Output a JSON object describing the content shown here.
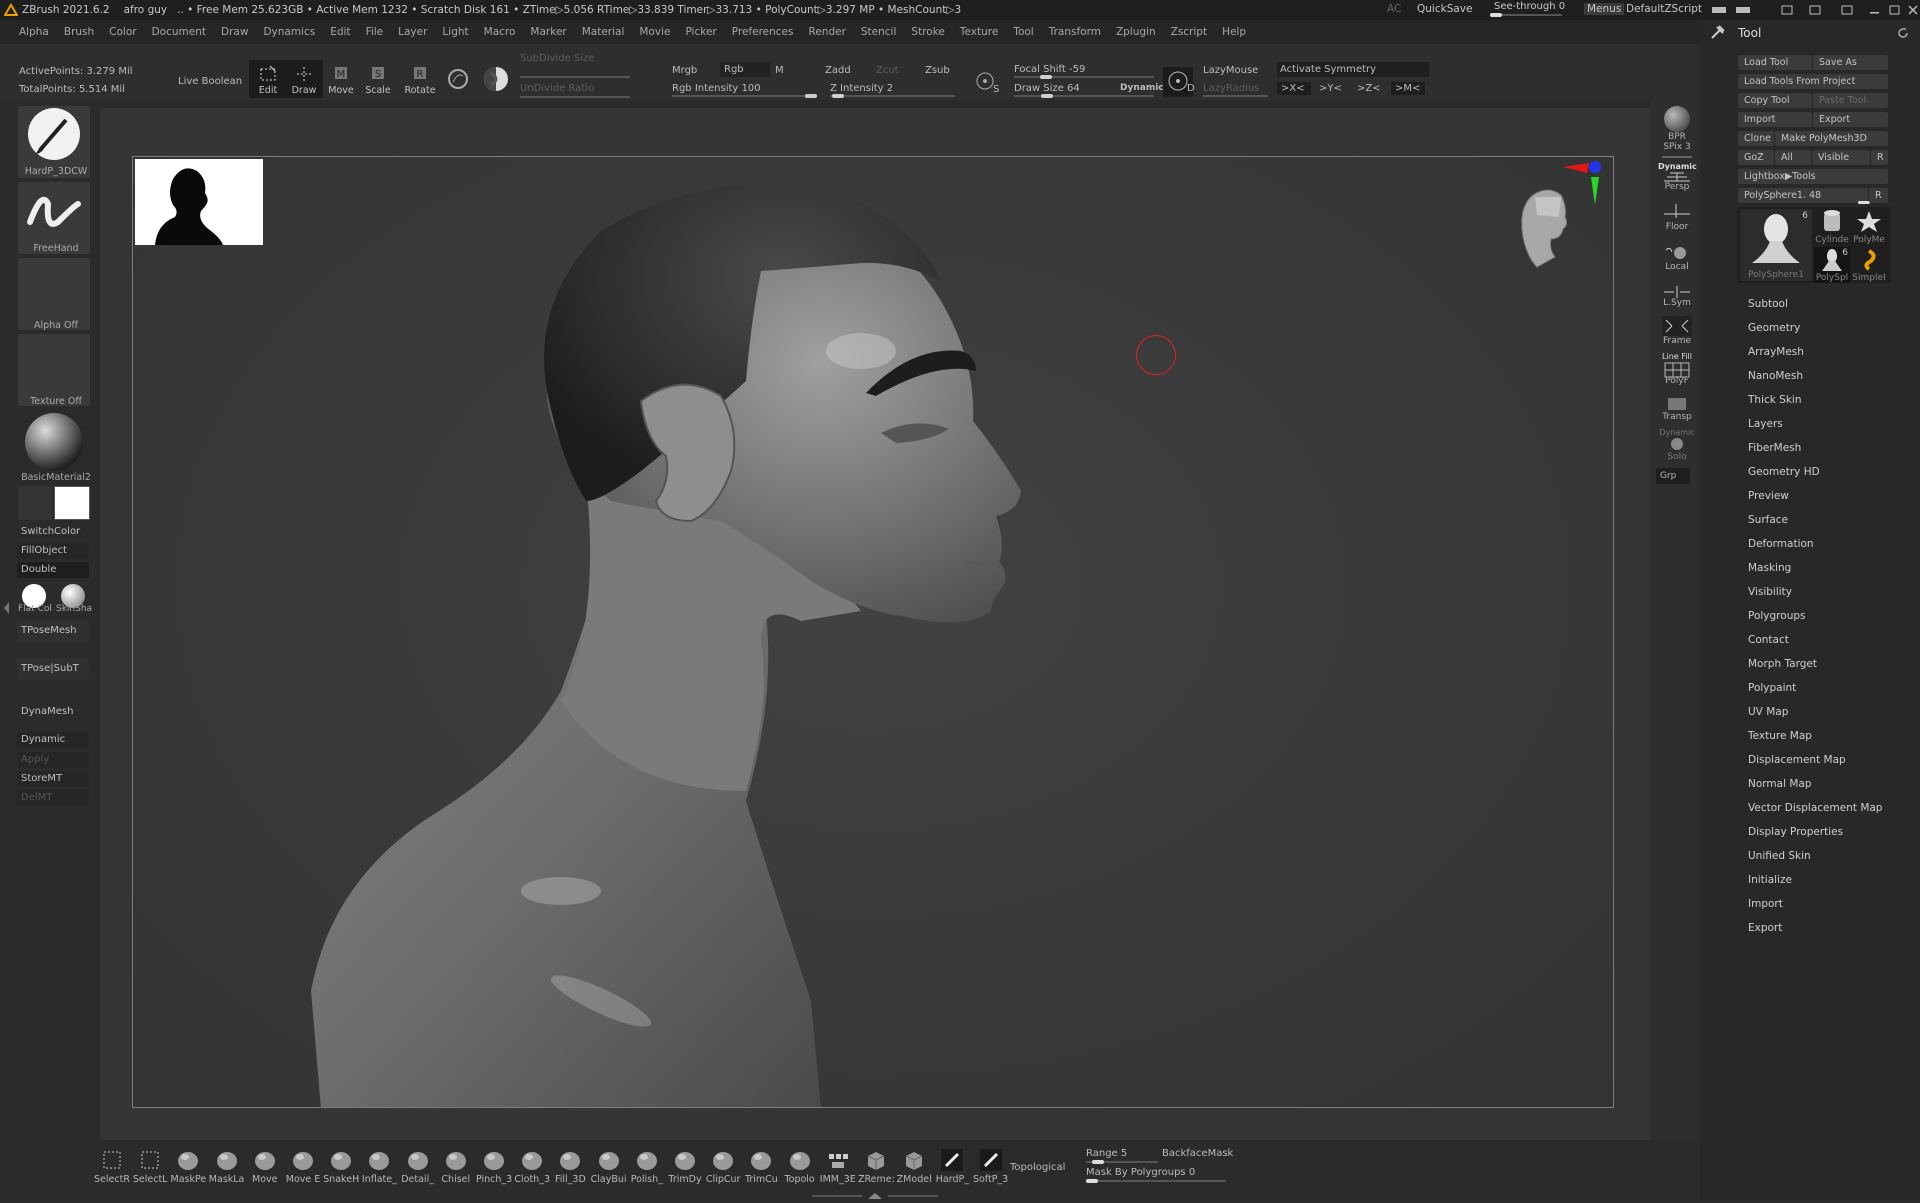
{
  "titlebar": {
    "app": "ZBrush 2021.6.2",
    "doc": "afro guy",
    "stats": ".. • Free Mem 25.623GB • Active Mem 1232 • Scratch Disk 161 •  ZTime▷5.056 RTime▷33.839 Timer▷33.713 • PolyCount▷3.297 MP  • MeshCount▷3",
    "ac": "AC",
    "quicksave": "QuickSave",
    "see_through": "See-through  0",
    "menus": "Menus",
    "script": "DefaultZScript"
  },
  "menu": [
    "Alpha",
    "Brush",
    "Color",
    "Document",
    "Draw",
    "Dynamics",
    "Edit",
    "File",
    "Layer",
    "Light",
    "Macro",
    "Marker",
    "Material",
    "Movie",
    "Picker",
    "Preferences",
    "Render",
    "Stencil",
    "Stroke",
    "Texture",
    "Tool",
    "Transform",
    "Zplugin",
    "Zscript",
    "Help"
  ],
  "shelf": {
    "active_points": "ActivePoints: 3.279 Mil",
    "total_points": "TotalPoints: 5.514 Mil",
    "live_boolean": "Live Boolean",
    "edit": "Edit",
    "draw": "Draw",
    "move": "Move",
    "scale": "Scale",
    "rotate": "Rotate",
    "subdivide_size": "SubDivide Size",
    "undivide_ratio": "UnDivide Ratio",
    "mrgb": "Mrgb",
    "rgb": "Rgb",
    "m": "M",
    "rgb_intensity": "Rgb Intensity 100",
    "zadd": "Zadd",
    "zcut": "Zcut",
    "zsub": "Zsub",
    "z_intensity": "Z Intensity 2",
    "focal_shift": "Focal Shift -59",
    "draw_size": "Draw Size 64",
    "dynamic": "Dynamic",
    "lazymouse": "LazyMouse",
    "lazyradius": "LazyRadius",
    "activate_symmetry": "Activate Symmetry",
    "sym_x": ">X<",
    "sym_y": ">Y<",
    "sym_z": ">Z<",
    "sym_m": ">M<",
    "s_label": "S",
    "d_label": "D",
    "pipe": "|",
    "rgb_intensity_value": 1.0,
    "z_intensity_value": 0.02,
    "focal_shift_value": -59,
    "draw_size_value": 64
  },
  "left": {
    "brush": "HardP_3DCW",
    "stroke": "FreeHand",
    "alpha": "Alpha Off",
    "texture": "Texture Off",
    "material": "BasicMaterial2",
    "switchcolor": "SwitchColor",
    "fillobject": "FillObject",
    "double": "Double",
    "flat_col": "Flat Col",
    "skinsha": "SkinSha",
    "tposemesh": "TPoseMesh",
    "tpose_subt": "TPose|SubT",
    "dynamesh": "DynaMesh",
    "dynamic": "Dynamic",
    "apply": "Apply",
    "storemt": "StoreMT",
    "delmt": "DelMT",
    "secondary_color": "#333333",
    "main_color": "#ffffff"
  },
  "right_shelf": {
    "bpr": "BPR",
    "spix": "SPix 3",
    "dynamic": "Dynamic",
    "persp": "Persp",
    "floor": "Floor",
    "local": "Local",
    "lsym": "L.Sym",
    "frame": "Frame",
    "line_fill": "Line Fill",
    "polyf": "PolyF",
    "transp": "Transp",
    "dynamic2": "Dynamic",
    "solo": "Solo",
    "grp": "Grp"
  },
  "tool": {
    "title": "Tool",
    "load_tool": "Load Tool",
    "save_as": "Save As",
    "load_from_project": "Load Tools From Project",
    "copy_tool": "Copy Tool",
    "paste_tool": "Paste Tool",
    "import": "Import",
    "export": "Export",
    "clone": "Clone",
    "make_polymesh": "Make PolyMesh3D",
    "goz": "GoZ",
    "all": "All",
    "visible": "Visible",
    "r": "R",
    "lightbox_tools": "Lightbox▶Tools",
    "polysphere": "PolySphere1. 48",
    "polysphere_value": 48,
    "thumbs": [
      {
        "name": "PolySphere1",
        "count": "6"
      },
      {
        "name": "Cylinde",
        "count": ""
      },
      {
        "name": "PolyMe",
        "count": ""
      },
      {
        "name": "PolySpl",
        "count": "6"
      },
      {
        "name": "SimpleI",
        "count": ""
      }
    ],
    "subpalettes": [
      "Subtool",
      "Geometry",
      "ArrayMesh",
      "NanoMesh",
      "Thick Skin",
      "Layers",
      "FiberMesh",
      "Geometry HD",
      "Preview",
      "Surface",
      "Deformation",
      "Masking",
      "Visibility",
      "Polygroups",
      "Contact",
      "Morph Target",
      "Polypaint",
      "UV Map",
      "Texture Map",
      "Displacement Map",
      "Normal Map",
      "Vector Displacement Map",
      "Display Properties",
      "Unified Skin",
      "Initialize",
      "Import",
      "Export"
    ]
  },
  "bottom": {
    "brushes": [
      "SelectR",
      "SelectL",
      "MaskPe",
      "MaskLa",
      "Move",
      "Move E",
      "SnakeH",
      "Inflate_",
      "Detail_",
      "Chisel",
      "Pinch_3",
      "Cloth_3",
      "Fill_3D",
      "ClayBui",
      "Polish_",
      "TrimDy",
      "ClipCur",
      "TrimCu",
      "Topolo",
      "IMM_3E",
      "ZReme:",
      "ZModel",
      "HardP_",
      "SoftP_3"
    ],
    "topological": "Topological",
    "range": "Range 5",
    "range_value": 5,
    "backfacemask": "BackfaceMask",
    "mask_by_polygroups": "Mask By Polygroups 0",
    "mask_by_polygroups_value": 0
  },
  "colors": {
    "accent": "#e8a000",
    "canvas": "#393939",
    "bg": "#2a2a2a"
  }
}
